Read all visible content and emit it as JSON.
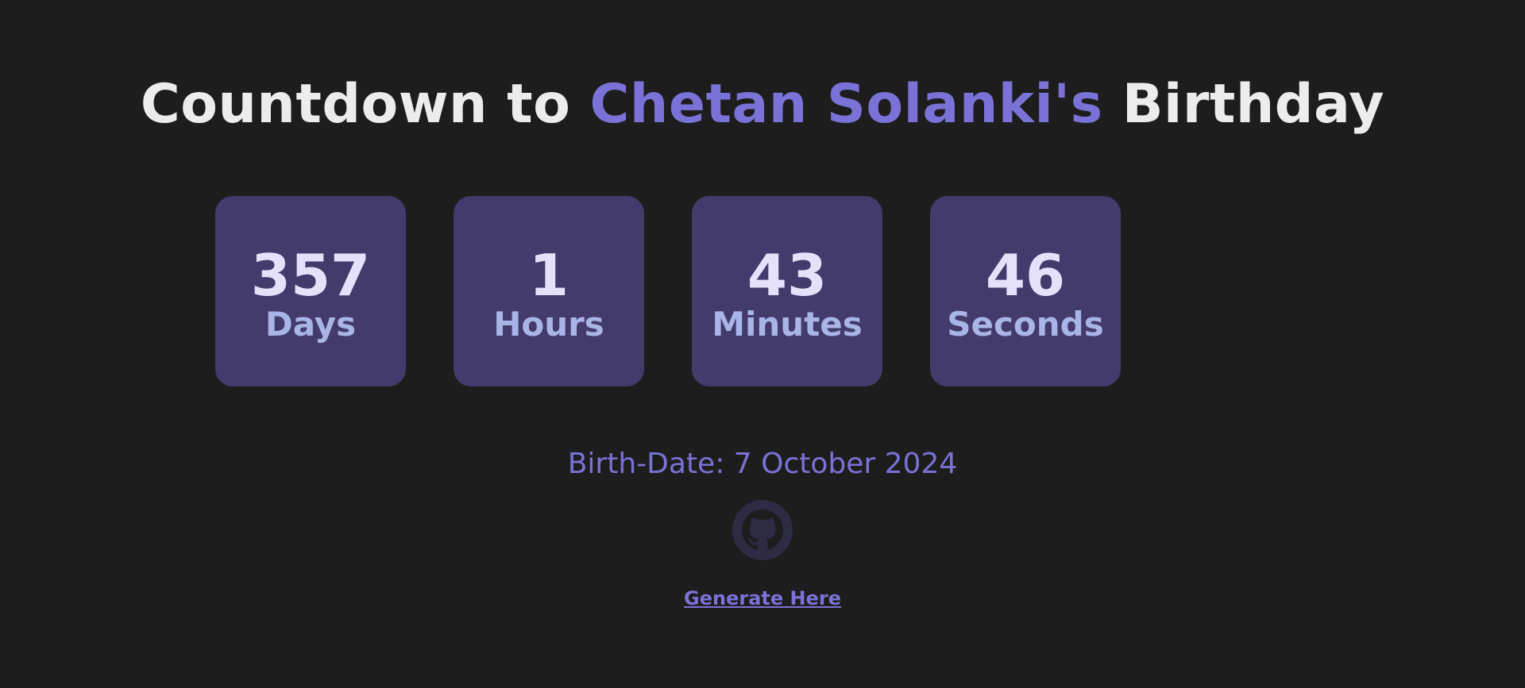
{
  "header": {
    "title_prefix": "Countdown to ",
    "name": "Chetan Solanki's",
    "title_suffix": " Birthday"
  },
  "countdown": [
    {
      "value": "357",
      "unit": "Days"
    },
    {
      "value": "1",
      "unit": "Hours"
    },
    {
      "value": "43",
      "unit": "Minutes"
    },
    {
      "value": "46",
      "unit": "Seconds"
    }
  ],
  "birthdate": "Birth-Date: 7 October 2024",
  "github": {
    "icon": "github-icon"
  },
  "link": {
    "label": "Generate Here"
  },
  "colors": {
    "background": "#1d1d1d",
    "accent": "#7a72d6",
    "box": "#433b6b",
    "number": "#e6e1fb",
    "unit": "#a9b5e6",
    "icon": "#2e2b45"
  }
}
